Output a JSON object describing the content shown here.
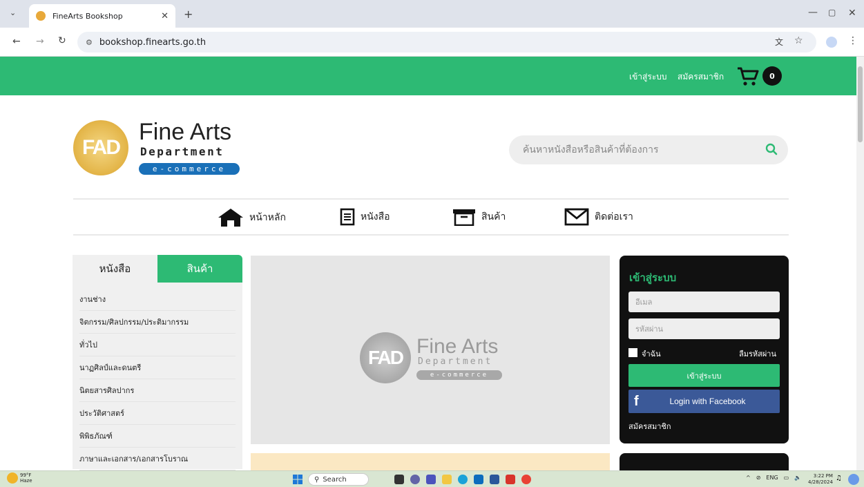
{
  "browser": {
    "tab_title": "FineArts Bookshop",
    "url": "bookshop.finearts.go.th"
  },
  "topbar": {
    "login_link": "เข้าสู่ระบบ",
    "register_link": "สมัครสมาชิก",
    "cart_count": "0"
  },
  "logo": {
    "mark": "FAD",
    "title": "Fine Arts",
    "subtitle": "Department",
    "ecommerce": "e-commerce"
  },
  "search": {
    "placeholder": "ค้นหาหนังสือหรือสินค้าที่ต้องการ"
  },
  "nav": [
    {
      "label": "หน้าหลัก",
      "icon": "home-icon"
    },
    {
      "label": "หนังสือ",
      "icon": "book-icon"
    },
    {
      "label": "สินค้า",
      "icon": "box-icon"
    },
    {
      "label": "ติดต่อเรา",
      "icon": "mail-icon"
    }
  ],
  "categories": {
    "tab_books": "หนังสือ",
    "tab_goods": "สินค้า",
    "items": [
      "งานช่าง",
      "จิตกรรม/ศิลปกรรม/ประติมากรรม",
      "ทั่วไป",
      "นาฏศิลป์และดนตรี",
      "นิตยสารศิลปากร",
      "ประวัติศาสตร์",
      "พิพิธภัณฑ์",
      "ภาษาและเอกสาร/เอกสารโบราณ"
    ]
  },
  "banner": {
    "mark": "FAD",
    "title": "Fine Arts",
    "subtitle": "Department",
    "ecommerce": "e-commerce"
  },
  "login": {
    "heading": "เข้าสู่ระบบ",
    "email_placeholder": "อีเมล",
    "password_placeholder": "รหัสผ่าน",
    "remember": "จำฉัน",
    "forgot": "ลืมรหัสผ่าน",
    "submit": "เข้าสู่ระบบ",
    "facebook": "Login with Facebook",
    "register": "สมัครสมาชิก"
  },
  "taskbar": {
    "weather_temp": "99°F",
    "weather_desc": "Haze",
    "search": "Search",
    "lang": "ENG",
    "time": "3:22 PM",
    "date": "4/28/2024"
  },
  "colors": {
    "brand_green": "#2dba74",
    "facebook_blue": "#3b5998"
  }
}
